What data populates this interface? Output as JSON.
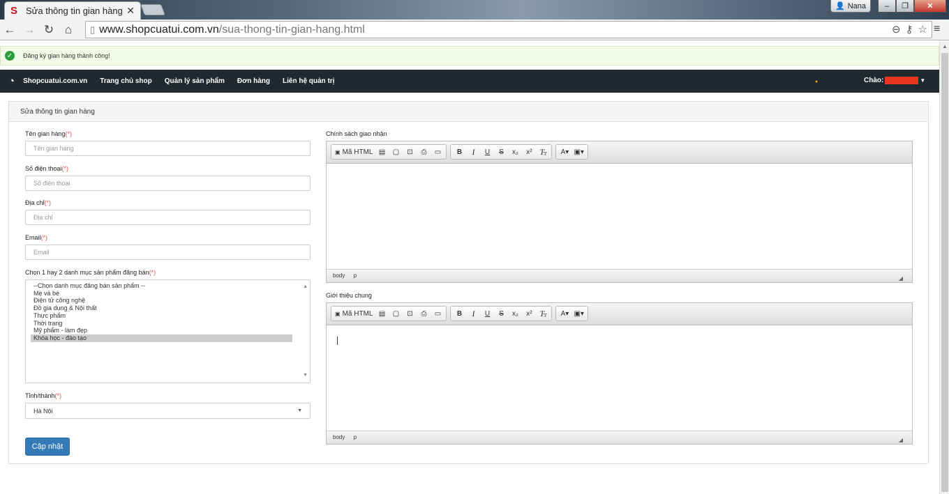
{
  "browser": {
    "tab_title": "Sửa thông tin gian hàng",
    "favicon": "S",
    "user": "Nana",
    "url_host": "www.shopcuatui.com.vn",
    "url_path": "/sua-thong-tin-gian-hang.html"
  },
  "alert": {
    "message": "Đăng ký gian hàng thành công!"
  },
  "nav": {
    "items": [
      "Shopcuatui.com.vn",
      "Trang chủ shop",
      "Quản lý sản phẩm",
      "Đơn hàng",
      "Liên hệ quản trị"
    ],
    "greeting": "Chào:"
  },
  "panel": {
    "title": "Sửa thông tin gian hàng"
  },
  "form": {
    "req_mark": "(*)",
    "name": {
      "label": "Tên gian hàng",
      "placeholder": "Tên gian hàng"
    },
    "phone": {
      "label": "Số điện thoại",
      "placeholder": "Số điện thoại"
    },
    "address": {
      "label": "Địa chỉ",
      "placeholder": "Địa chỉ"
    },
    "email": {
      "label": "Email",
      "placeholder": "Email"
    },
    "categories": {
      "label": "Chọn 1 hay 2 danh mục sản phẩm đăng bán",
      "options": [
        "--Chọn danh mục đăng bán sản phẩm --",
        "Mẹ và bé",
        "Điện tử công nghệ",
        "Đồ gia dụng & Nội thất",
        "Thực phẩm",
        "Thời trang",
        "Mỹ phẩm - làm đẹp",
        "Khóa học - đào tạo"
      ],
      "selected_index": 7
    },
    "province": {
      "label": "Tỉnh/thành",
      "value": "Hà Nội"
    },
    "submit": "Cập nhật"
  },
  "editors": {
    "toolbar_source": "Mã HTML",
    "footer_path": [
      "body",
      "p"
    ],
    "shipping_label": "Chính sách giao nhận",
    "intro_label": "Giới thiệu chung"
  }
}
